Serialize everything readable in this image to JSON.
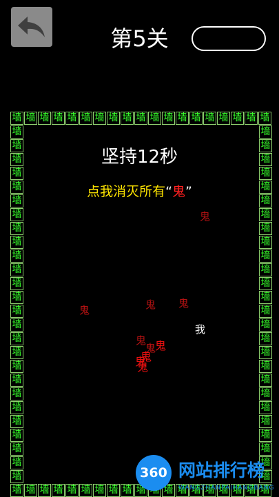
{
  "header": {
    "level_title": "第5关",
    "back_icon": "undo-arrow-icon"
  },
  "game": {
    "timer_text": "坚持12秒",
    "instruction_prefix": "点我消灭所有",
    "instruction_open_quote": "“",
    "instruction_target": "鬼",
    "instruction_close_quote": "”",
    "wall_char": "墙",
    "ghost_char": "鬼",
    "player_char": "我"
  },
  "watermark": {
    "badge": "360",
    "name": "网站排行榜",
    "subtitle": "WANGZHANPAIHANGBANG"
  },
  "colors": {
    "background": "#000000",
    "wall_text": "#36ff2a",
    "instruction": "#ffe500",
    "ghost": "#b31212",
    "accent_blue": "#1b8df0"
  }
}
